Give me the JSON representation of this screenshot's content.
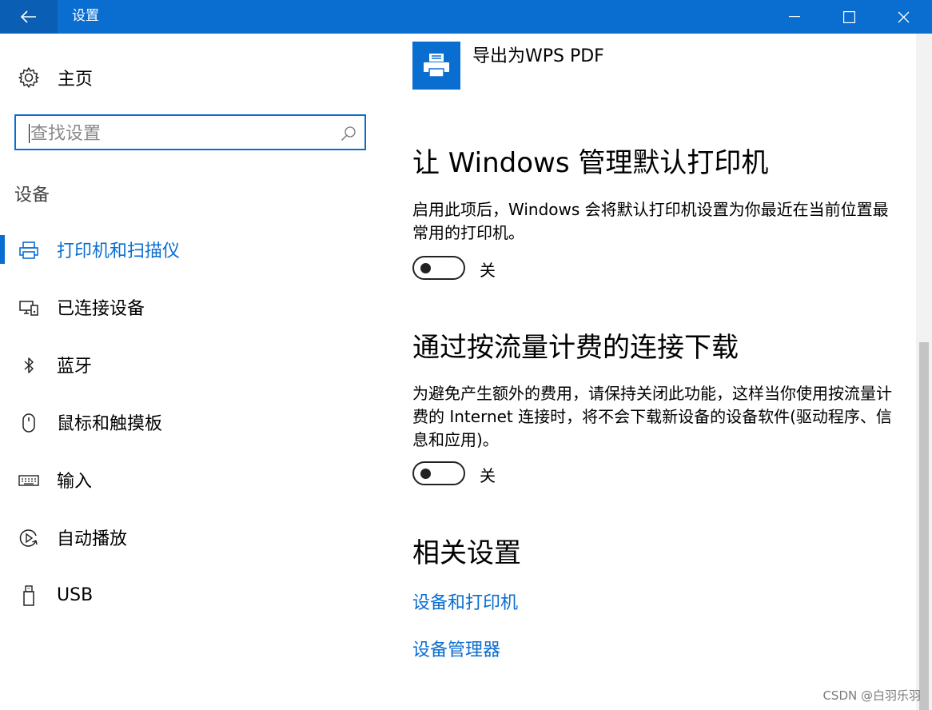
{
  "window": {
    "title": "设置"
  },
  "sidebar": {
    "home_label": "主页",
    "search_placeholder": "查找设置",
    "section_label": "设备",
    "items": [
      {
        "label": "打印机和扫描仪",
        "icon": "printer-icon",
        "active": true
      },
      {
        "label": "已连接设备",
        "icon": "connected-devices-icon"
      },
      {
        "label": "蓝牙",
        "icon": "bluetooth-icon"
      },
      {
        "label": "鼠标和触摸板",
        "icon": "mouse-icon"
      },
      {
        "label": "输入",
        "icon": "keyboard-icon"
      },
      {
        "label": "自动播放",
        "icon": "autoplay-icon"
      },
      {
        "label": "USB",
        "icon": "usb-icon"
      }
    ]
  },
  "main": {
    "printer_tile_label": "导出为WPS PDF",
    "default_printer": {
      "heading": "让 Windows 管理默认打印机",
      "description": "启用此项后，Windows 会将默认打印机设置为你最近在当前位置最常用的打印机。",
      "toggle_state": "关"
    },
    "metered_download": {
      "heading": "通过按流量计费的连接下载",
      "description": "为避免产生额外的费用，请保持关闭此功能，这样当你使用按流量计费的 Internet 连接时，将不会下载新设备的设备软件(驱动程序、信息和应用)。",
      "toggle_state": "关"
    },
    "related": {
      "heading": "相关设置",
      "links": [
        "设备和打印机",
        "设备管理器"
      ]
    }
  },
  "watermark": "CSDN @白羽乐羽",
  "colors": {
    "accent": "#0a6ed1",
    "titlebar": "#0a6ed1"
  }
}
